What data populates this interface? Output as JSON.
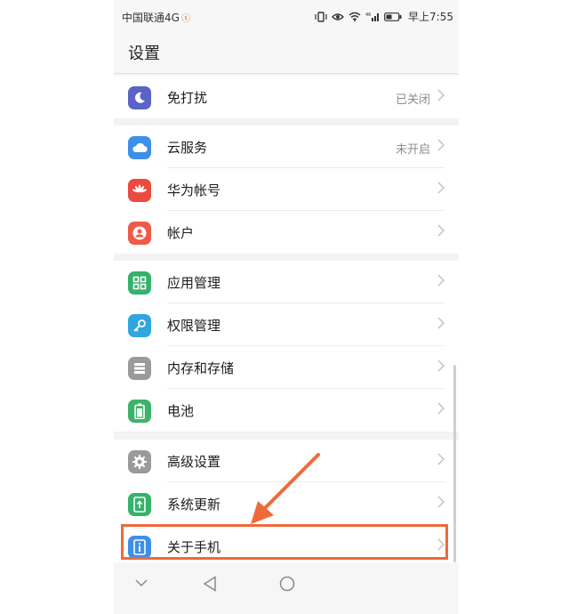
{
  "status_bar": {
    "carrier": "中国联通4G",
    "time": "早上7:55"
  },
  "header": {
    "title": "设置"
  },
  "settings": [
    {
      "label": "免打扰",
      "value": "已关闭",
      "icon": "moon-icon",
      "color": "#5b63c6"
    },
    {
      "label": "云服务",
      "value": "未开启",
      "icon": "cloud-icon",
      "color": "#3d8fe8"
    },
    {
      "label": "华为帐号",
      "value": "",
      "icon": "huawei-logo-icon",
      "color": "#ea4a3f"
    },
    {
      "label": "帐户",
      "value": "",
      "icon": "user-icon",
      "color": "#ef5a4a"
    },
    {
      "label": "应用管理",
      "value": "",
      "icon": "apps-grid-icon",
      "color": "#35b26b"
    },
    {
      "label": "权限管理",
      "value": "",
      "icon": "key-icon",
      "color": "#2fa6de"
    },
    {
      "label": "内存和存储",
      "value": "",
      "icon": "storage-icon",
      "color": "#9a9a9a"
    },
    {
      "label": "电池",
      "value": "",
      "icon": "battery-icon",
      "color": "#3db36a"
    },
    {
      "label": "高级设置",
      "value": "",
      "icon": "gear-icon",
      "color": "#9a9a9a"
    },
    {
      "label": "系统更新",
      "value": "",
      "icon": "system-update-icon",
      "color": "#35b26b"
    },
    {
      "label": "关于手机",
      "value": "",
      "icon": "info-icon",
      "color": "#3d8fe8"
    }
  ],
  "accent": "#ee6a39"
}
